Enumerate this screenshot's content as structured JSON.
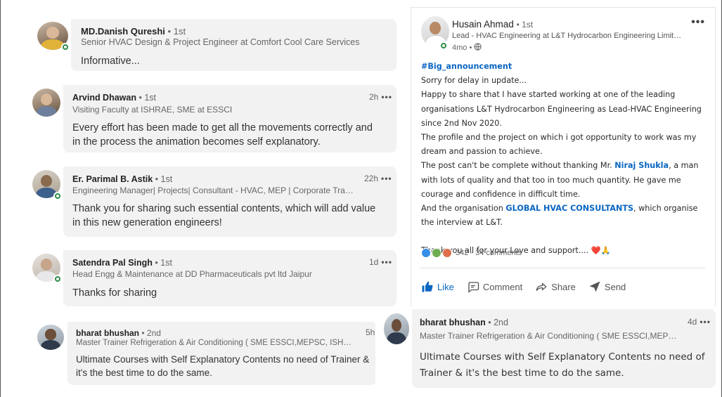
{
  "comments": [
    {
      "name": "MD.Danish Qureshi",
      "degree": "• 1st",
      "headline": "Senior HVAC Design & Project Engineer at Comfort Cool Care Services",
      "time": "",
      "text": "Informative..."
    },
    {
      "name": "Arvind Dhawan",
      "degree": "• 1st",
      "headline": "Visiting Faculty at ISHRAE, SME at ESSCI",
      "time": "2h",
      "text": "Every effort has been made to get all the movements correctly and in the process the animation becomes self explanatory."
    },
    {
      "name": "Er. Parimal B. Astik",
      "degree": "• 1st",
      "headline": "Engineering Manager| Projects| Consultant - HVAC, MEP | Corporate Train...",
      "time": "22h",
      "text": "Thank you for sharing such essential contents, which will add value in this new generation engineers!"
    },
    {
      "name": "Satendra Pal Singh",
      "degree": "• 1st",
      "headline": "Head Engg & Maintenance at DD Pharmaceuticals pvt ltd Jaipur",
      "time": "1d",
      "text": "Thanks for sharing"
    },
    {
      "name": "bharat bhushan",
      "degree": "• 2nd",
      "headline": "Master Trainer Refrigeration & Air Conditioning ( SME ESSCI,MEPSC, ISHA...",
      "time": "5h",
      "text": "Ultimate Courses with Self Explanatory Contents no need of Trainer & it's the best time to do the same."
    }
  ],
  "more_label": "•••",
  "post": {
    "author": "Husain Ahmad",
    "degree": "• 1st",
    "headline": "Lead - HVAC Engineering at L&T Hydrocarbon Engineering Limited |Mechani...",
    "time": "4mo •",
    "hashtag": "#Big_announcement",
    "lines": {
      "l1": "Sorry for delay in update...",
      "l2": "Happy to share that I have started working at one of the leading organisations L&T Hydrocarbon Engineering as Lead-HVAC Engineering since 2nd Nov 2020.",
      "l3": "The profile and the project on which i got opportunity to work was my dream and passion to achieve.",
      "l4a": "The post can't be complete without thanking Mr. ",
      "l4link": "Niraj Shukla",
      "l4b": ", a man with lots of quality and that too in too much quantity. He gave me courage and confidence in difficult time.",
      "l5a": "And the organisation ",
      "l5link": "GLOBAL HVAC CONSULTANTS",
      "l5b": ", which organise the interview at L&T.",
      "l6": "Thank you all for your Love and support....",
      "emoji": "❤️🙏"
    },
    "reactions_count": "342",
    "comments_count": "· 34 comments",
    "actions": {
      "like": "Like",
      "comment": "Comment",
      "share": "Share",
      "send": "Send"
    }
  },
  "reply": {
    "name": "bharat bhushan",
    "degree": "• 2nd",
    "headline": "Master Trainer Refrigeration & Air Conditioning ( SME ESSCI,MEPSC, ISHA...",
    "time": "4d",
    "text": "Ultimate Courses with Self Explanatory Contents no need of Trainer & it's the best time to do the same."
  },
  "colors": {
    "link": "#0a66c2",
    "bubble": "#f2f2f2",
    "online": "#2e8b45"
  }
}
